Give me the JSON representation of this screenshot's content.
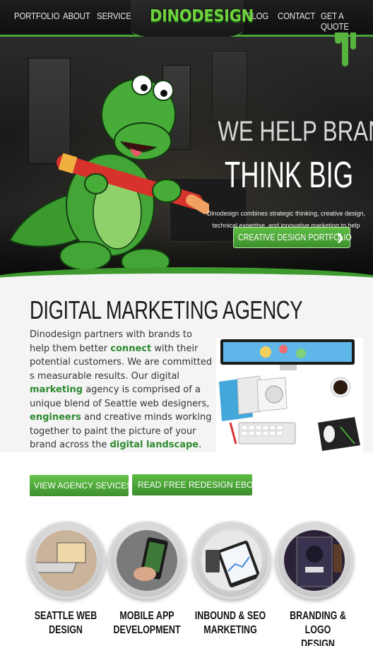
{
  "nav": {
    "left": [
      "PORTFOLIO",
      "ABOUT",
      "SERVICES"
    ],
    "logo": "DINODESIGN",
    "right": [
      "BLOG",
      "CONTACT",
      "GET A QUOTE"
    ]
  },
  "hero": {
    "headline": "WE HELP BRANDS",
    "subheadline": "THINK BIG",
    "description": "Dinodesign combines strategic thinking, creative design, technical expertise, and innovative marketing to help businesses become more successful.",
    "cta": "CREATIVE DESIGN PORTFOLIO",
    "cta_icon": "chevron-right-icon"
  },
  "agency": {
    "title": "DIGITAL MARKETING AGENCY",
    "p1": "Dinodesign partners with brands to help them better ",
    "k1": "connect",
    "p2": " with their potential customers. We are committed s measurable results. Our digital ",
    "k2": "marketing",
    "p3": " agency is comprised of a unique blend of Seattle web designers, ",
    "k3": "engineers",
    "p4": " and creative minds working together to paint the picture of your brand across the ",
    "k4": "digital landscape",
    "p5": "."
  },
  "buttons": {
    "services": "VIEW AGENCY SEVICES",
    "ebook": "READ FREE REDESIGN EBOOK"
  },
  "services": [
    {
      "line1": "SEATTLE WEB",
      "line2": "DESIGN",
      "icon": "laptop-icon"
    },
    {
      "line1": "MOBILE APP",
      "line2": "DEVELOPMENT",
      "icon": "smartphone-icon"
    },
    {
      "line1": "INBOUND & SEO",
      "line2": "MARKETING",
      "icon": "tablet-chart-icon"
    },
    {
      "line1": "BRANDING & LOGO",
      "line2": "DESIGN",
      "icon": "billboard-icon"
    }
  ],
  "colors": {
    "brand_green": "#4aa43a",
    "keyword_green": "#2f8a2f",
    "nav_bg": "#161616"
  }
}
